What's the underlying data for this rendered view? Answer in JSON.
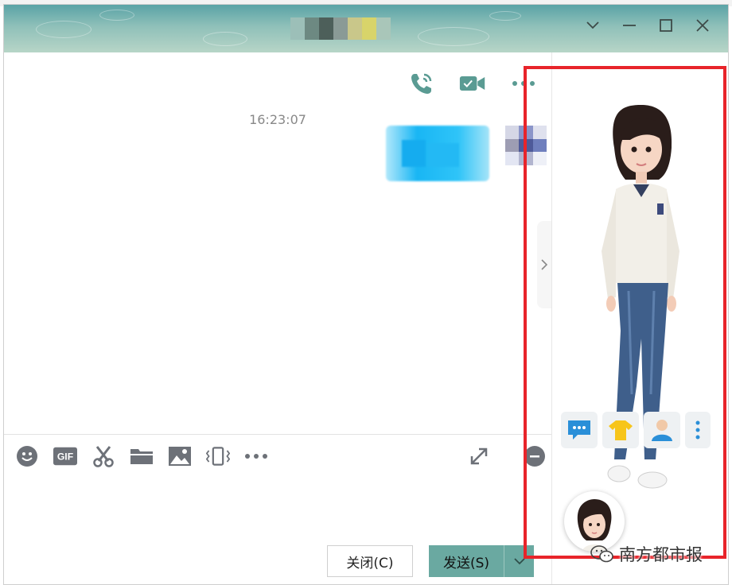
{
  "window": {
    "title_obscured": true,
    "controls": [
      "chevron-down",
      "minimize",
      "maximize",
      "close"
    ]
  },
  "header": {
    "actions": [
      "voice-call",
      "video-call",
      "more"
    ]
  },
  "chat": {
    "timestamp": "16:23:07"
  },
  "toolbar": {
    "items": [
      "emoji",
      "gif",
      "screenshot",
      "file",
      "image",
      "shake",
      "more"
    ],
    "gif_label": "GIF",
    "right_items": [
      "expand",
      "history"
    ]
  },
  "buttons": {
    "close_label": "关闭(C)",
    "send_label": "发送(S)"
  },
  "side_panel": {
    "tools": [
      "chat-bubble",
      "outfit",
      "profile",
      "more"
    ]
  },
  "watermark": {
    "text": "南方都市报"
  },
  "colors": {
    "accent": "#5a9b93",
    "send_button": "#6aa9a1",
    "highlight_frame": "#e8242a",
    "bubble": "#1ab4f1"
  }
}
